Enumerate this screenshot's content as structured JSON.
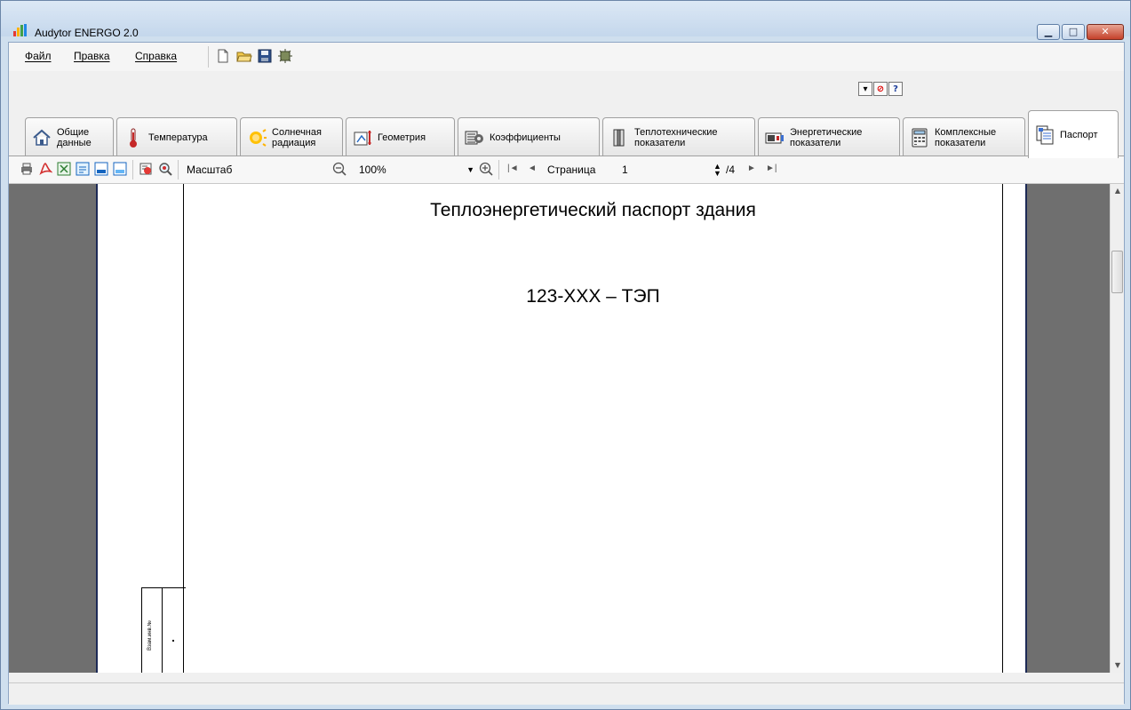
{
  "window": {
    "title": "Audytor ENERGO 2.0",
    "caption_buttons": [
      "minimize",
      "maximize",
      "close"
    ]
  },
  "menubar": {
    "items": [
      {
        "label": "Файл"
      },
      {
        "label": "Правка"
      },
      {
        "label": "Справка"
      }
    ],
    "tools": [
      "new-file-icon",
      "open-folder-icon",
      "save-icon",
      "settings-icon"
    ]
  },
  "mini_buttons": [
    "dropdown-icon",
    "stop-icon",
    "help-icon"
  ],
  "mini_glyphs": {
    "dropdown": "▾",
    "stop": "⊘",
    "help": "?"
  },
  "tabs": [
    {
      "label": "Общие\nданные",
      "icon": "home-icon"
    },
    {
      "label": "Температура",
      "icon": "thermometer-icon"
    },
    {
      "label": "Солнечная\nрадиация",
      "icon": "sun-icon"
    },
    {
      "label": "Геометрия",
      "icon": "geometry-icon"
    },
    {
      "label": "Коэффициенты",
      "icon": "coefficients-icon"
    },
    {
      "label": "Теплотехнические\nпоказатели",
      "icon": "thermal-icon"
    },
    {
      "label": "Энергетические\nпоказатели",
      "icon": "energy-icon"
    },
    {
      "label": "Комплексные\nпоказатели",
      "icon": "calculator-icon"
    },
    {
      "label": "Паспорт",
      "icon": "passport-icon",
      "active": true
    }
  ],
  "report_toolbar": {
    "scale_label": "Масштаб",
    "zoom_value": "100%",
    "page_label": "Страница",
    "page_value": "1",
    "page_total": "/4"
  },
  "document": {
    "title": "Теплоэнергетический паспорт здания",
    "code": "123-XXX – ТЭП",
    "stamp_text": "Взам.инв.№"
  },
  "colors": {
    "title_bar": "#c4d7ec",
    "preview_bg": "#6f6f6f",
    "page_border": "#1d2a56",
    "close_button": "#c4412a"
  }
}
